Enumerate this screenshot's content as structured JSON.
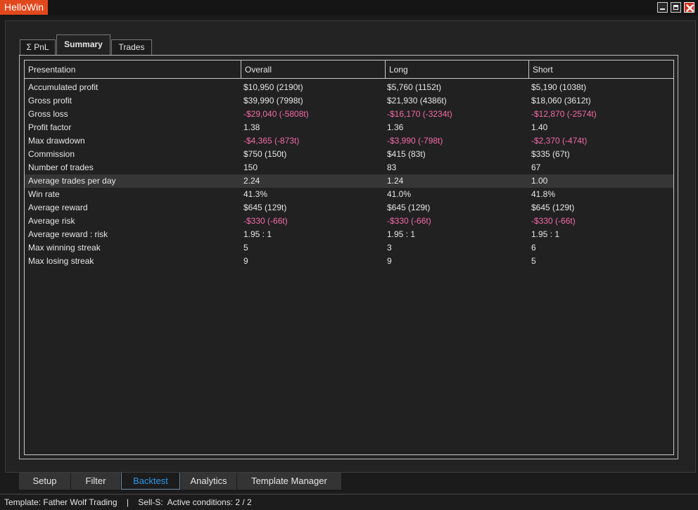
{
  "app": {
    "title": "HelloWin"
  },
  "tabs": [
    {
      "label": "Σ PnL"
    },
    {
      "label": "Summary"
    },
    {
      "label": "Trades"
    }
  ],
  "table": {
    "headers": [
      "Presentation",
      "Overall",
      "Long",
      "Short"
    ],
    "rows": [
      {
        "label": "Accumulated profit",
        "overall": "$10,950 (2190t)",
        "long": "$5,760 (1152t)",
        "short": "$5,190 (1038t)"
      },
      {
        "label": "Gross profit",
        "overall": "$39,990 (7998t)",
        "long": "$21,930 (4386t)",
        "short": "$18,060 (3612t)"
      },
      {
        "label": "Gross loss",
        "overall": "-$29,040 (-5808t)",
        "long": "-$16,170 (-3234t)",
        "short": "-$12,870 (-2574t)"
      },
      {
        "label": "Profit factor",
        "overall": "1.38",
        "long": "1.36",
        "short": "1.40"
      },
      {
        "label": "Max drawdown",
        "overall": "-$4,365 (-873t)",
        "long": "-$3,990 (-798t)",
        "short": "-$2,370 (-474t)"
      },
      {
        "label": "Commission",
        "overall": "$750 (150t)",
        "long": "$415 (83t)",
        "short": "$335 (67t)"
      },
      {
        "label": "Number of trades",
        "overall": "150",
        "long": "83",
        "short": "67"
      },
      {
        "label": "Average trades per day",
        "overall": "2.24",
        "long": "1.24",
        "short": "1.00"
      },
      {
        "label": "Win rate",
        "overall": "41.3%",
        "long": "41.0%",
        "short": "41.8%"
      },
      {
        "label": "Average reward",
        "overall": "$645 (129t)",
        "long": "$645 (129t)",
        "short": "$645 (129t)"
      },
      {
        "label": "Average risk",
        "overall": "-$330 (-66t)",
        "long": "-$330 (-66t)",
        "short": "-$330 (-66t)"
      },
      {
        "label": "Average reward : risk",
        "overall": "1.95 : 1",
        "long": "1.95 : 1",
        "short": "1.95 : 1"
      },
      {
        "label": "Max winning streak",
        "overall": "5",
        "long": "3",
        "short": "6"
      },
      {
        "label": "Max losing streak",
        "overall": "9",
        "long": "9",
        "short": "5"
      }
    ]
  },
  "bottom_tabs": [
    {
      "label": "Setup"
    },
    {
      "label": "Filter"
    },
    {
      "label": "Backtest"
    },
    {
      "label": "Analytics"
    },
    {
      "label": "Template Manager"
    }
  ],
  "status": {
    "text": "Template: Father Wolf Trading    |    Sell-S:  Active conditions: 2 / 2"
  },
  "colors": {
    "accent": "#e2481d",
    "negative": "#f36aa6",
    "selected_tab": "#2f97e4"
  },
  "icons": {
    "minimize": "minimize-icon",
    "maximize": "maximize-icon",
    "close": "close-icon"
  }
}
